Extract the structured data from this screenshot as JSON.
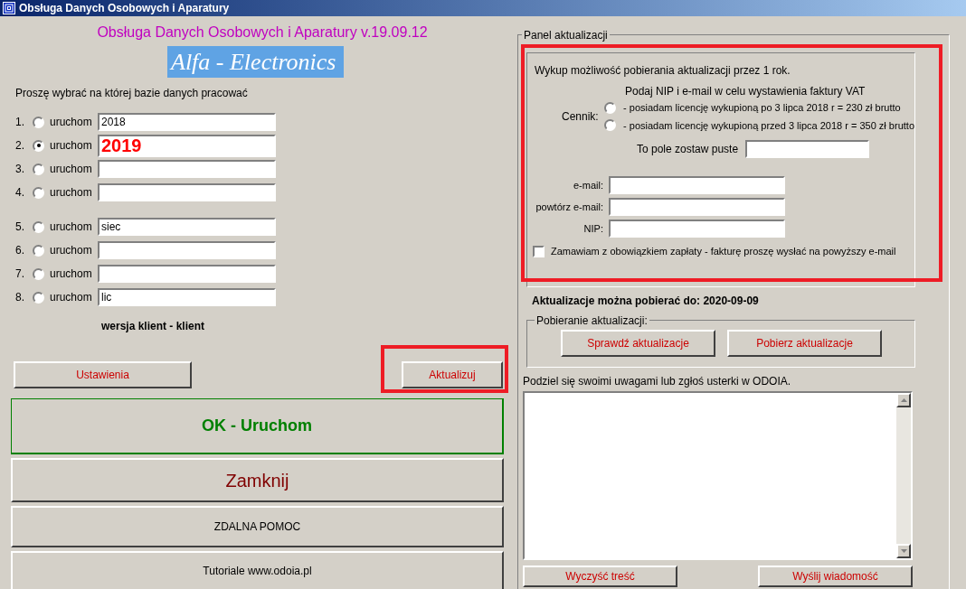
{
  "window": {
    "title": "Obsługa Danych Osobowych i Aparatury"
  },
  "heading": "Obsługa Danych Osobowych i Aparatury v.19.09.12",
  "logo": "Alfa - Electronics",
  "prompt": "Proszę wybrać na której bazie danych pracować",
  "databases": [
    {
      "number": "1.",
      "label": "uruchom",
      "value": "2018",
      "selected": false,
      "kind": "plain"
    },
    {
      "number": "2.",
      "label": "uruchom",
      "value": "2019",
      "selected": true,
      "kind": "emphasized"
    },
    {
      "number": "3.",
      "label": "uruchom",
      "selected": false,
      "kind": "plain"
    },
    {
      "number": "4.",
      "label": "uruchom",
      "selected": false,
      "kind": "plain"
    },
    {
      "number": "5.",
      "label": "uruchom",
      "value": "siec",
      "selected": false,
      "kind": "plain"
    },
    {
      "number": "6.",
      "label": "uruchom",
      "selected": false,
      "kind": "plain"
    },
    {
      "number": "7.",
      "label": "uruchom",
      "selected": false,
      "kind": "plain"
    },
    {
      "number": "8.",
      "label": "uruchom",
      "value": "lic",
      "selected": false,
      "kind": "plain"
    }
  ],
  "version": "wersja klient - klient",
  "settings_button": "Ustawienia",
  "update_button": "Aktualizuj",
  "ok_button": "OK - Uruchom",
  "close_button": "Zamknij",
  "remote_help_button": "ZDALNA POMOC",
  "tutorials_button": "Tutoriale www.odoia.pl",
  "update_panel": {
    "title": "Panel aktualizacji",
    "intro": "Wykup możliwość pobierania aktualizacji przez 1 rok.",
    "subtitle": "Podaj NIP i e-mail w celu wystawienia faktury  VAT",
    "price_label": "Cennik:",
    "price_options": [
      {
        "label": "- posiadam  licencję wykupioną po 3 lipca 2018 r = 230 zł brutto",
        "selected": false
      },
      {
        "label": "- posiadam licencję wykupioną przed 3 lipca 2018 r = 350 zł brutto",
        "selected": false
      }
    ],
    "empty_field_label": "To pole zostaw puste",
    "fields": [
      {
        "label": "e-mail:"
      },
      {
        "label": "powtórz e-mail:"
      },
      {
        "label": "NIP:"
      }
    ],
    "order_checkbox": {
      "label": "Zamawiam z obowiązkiem zapłaty - fakturę proszę wysłać na powyższy  e-mail",
      "checked": false
    },
    "expiry": "Aktualizacje można pobierać do: 2020-09-09",
    "download_group": {
      "title": "Pobieranie aktualizacji:",
      "buttons": [
        "Sprawdź aktualizacje",
        "Pobierz aktualizacje"
      ]
    },
    "feedback_label": "Podziel się swoimi uwagami lub zgłoś usterki w ODOIA.",
    "feedback_buttons": [
      "Wyczyść treść",
      "Wyślij wiadomość"
    ]
  }
}
